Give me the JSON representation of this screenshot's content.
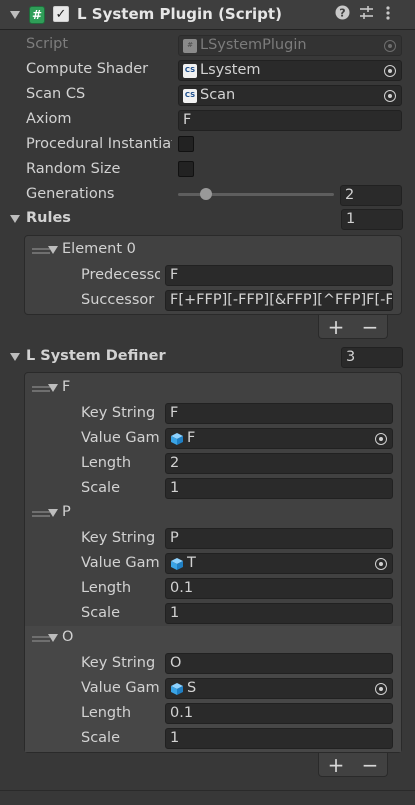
{
  "header": {
    "script_icon_glyph": "#",
    "title": "L System Plugin (Script)",
    "enabled": true,
    "help_icon": "question-circle-icon",
    "presets_icon": "sliders-icon",
    "menu_icon": "kebab-icon"
  },
  "fields": {
    "script": {
      "label": "Script",
      "value": "LSystemPlugin"
    },
    "compute_shader": {
      "label": "Compute Shader",
      "value": "Lsystem"
    },
    "scan_cs": {
      "label": "Scan CS",
      "value": "Scan"
    },
    "axiom": {
      "label": "Axiom",
      "value": "F"
    },
    "procedural": {
      "label": "Procedural Instantiation",
      "checked": false
    },
    "random_size": {
      "label": "Random Size",
      "checked": false
    },
    "generations": {
      "label": "Generations",
      "value": "2",
      "slider_fraction": 0.18
    }
  },
  "rules": {
    "label": "Rules",
    "size": "1",
    "element": {
      "label": "Element 0",
      "predecessor_label": "Predecessor",
      "predecessor": "F",
      "successor_label": "Successor",
      "successor": "F[+FFP][-FFP][&FFP][^FFP]F[-FFP]"
    },
    "add": "+",
    "remove": "−"
  },
  "definer": {
    "label": "L System Definer",
    "size": "3",
    "key_label": "Key String",
    "value_label": "Value GameObject",
    "length_label": "Length",
    "scale_label": "Scale",
    "items": [
      {
        "name": "F",
        "key": "F",
        "value": "F",
        "length": "2",
        "scale": "1"
      },
      {
        "name": "P",
        "key": "P",
        "value": "T",
        "length": "0.1",
        "scale": "1"
      },
      {
        "name": "O",
        "key": "O",
        "value": "S",
        "length": "0.1",
        "scale": "1"
      }
    ],
    "add": "+",
    "remove": "−"
  },
  "colors": {
    "background": "#383838",
    "field": "#2a2a2a",
    "script_icon": "#2f9e58",
    "text": "#d2d2d2"
  }
}
